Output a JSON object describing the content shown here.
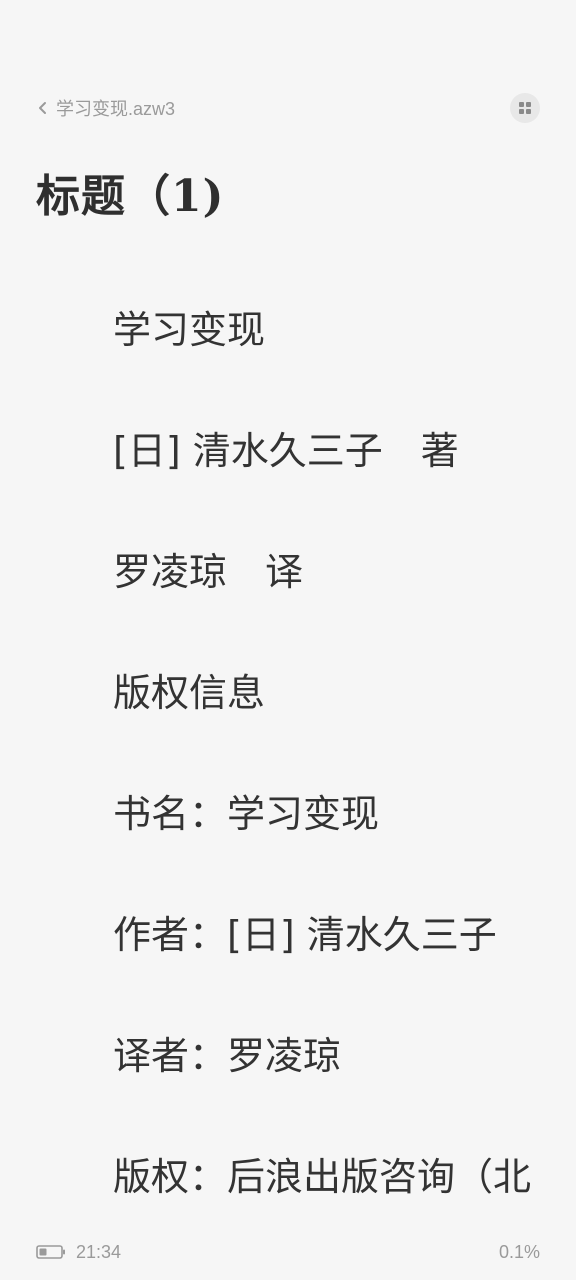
{
  "header": {
    "book_file": "学习变现.azw3",
    "back_icon": "chevron-left-icon",
    "menu_icon": "grid-icon"
  },
  "chapter": {
    "title": "标题（1)"
  },
  "content": {
    "lines": [
      "学习变现",
      "[日] 清水久三子　著",
      "罗凌琼　译",
      "版权信息",
      "书名：学习变现",
      "作者：[日] 清水久三子",
      "译者：罗凌琼",
      "版权：后浪出版咨询（北"
    ]
  },
  "status": {
    "battery_icon": "battery-icon",
    "time": "21:34",
    "progress": "0.1%"
  },
  "colors": {
    "background": "#f6f6f6",
    "text": "#333333",
    "muted": "#9a9a9a"
  }
}
